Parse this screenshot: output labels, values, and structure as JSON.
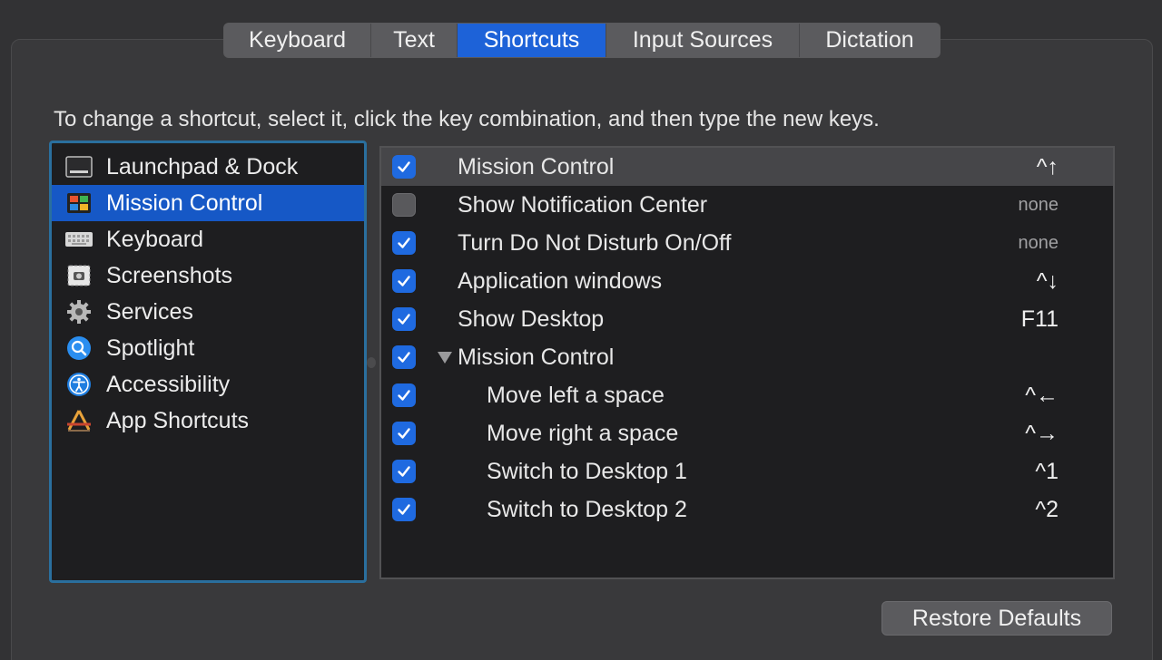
{
  "tabs": [
    {
      "label": "Keyboard",
      "active": false
    },
    {
      "label": "Text",
      "active": false
    },
    {
      "label": "Shortcuts",
      "active": true
    },
    {
      "label": "Input Sources",
      "active": false
    },
    {
      "label": "Dictation",
      "active": false
    }
  ],
  "instruction": "To change a shortcut, select it, click the key combination, and then type the new keys.",
  "categories": [
    {
      "label": "Launchpad & Dock",
      "icon": "launchpad-icon",
      "selected": false
    },
    {
      "label": "Mission Control",
      "icon": "mission-control-icon",
      "selected": true
    },
    {
      "label": "Keyboard",
      "icon": "keyboard-icon",
      "selected": false
    },
    {
      "label": "Screenshots",
      "icon": "screenshot-icon",
      "selected": false
    },
    {
      "label": "Services",
      "icon": "gear-icon",
      "selected": false
    },
    {
      "label": "Spotlight",
      "icon": "magnifier-icon",
      "selected": false
    },
    {
      "label": "Accessibility",
      "icon": "accessibility-icon",
      "selected": false
    },
    {
      "label": "App Shortcuts",
      "icon": "app-store-icon",
      "selected": false
    }
  ],
  "shortcuts": [
    {
      "label": "Mission Control",
      "checked": true,
      "key": "^↑",
      "selected": true
    },
    {
      "label": "Show Notification Center",
      "checked": false,
      "key": "none"
    },
    {
      "label": "Turn Do Not Disturb On/Off",
      "checked": true,
      "key": "none"
    },
    {
      "label": "Application windows",
      "checked": true,
      "key": "^↓"
    },
    {
      "label": "Show Desktop",
      "checked": true,
      "key": "F11"
    },
    {
      "label": "Mission Control",
      "checked": true,
      "key": "",
      "group": true
    },
    {
      "label": "Move left a space",
      "checked": true,
      "key": "^←",
      "indent": true
    },
    {
      "label": "Move right a space",
      "checked": true,
      "key": "^→",
      "indent": true
    },
    {
      "label": "Switch to Desktop 1",
      "checked": true,
      "key": "^1",
      "indent": true
    },
    {
      "label": "Switch to Desktop 2",
      "checked": true,
      "key": "^2",
      "indent": true
    }
  ],
  "restore_label": "Restore Defaults",
  "colors": {
    "accent": "#1d62d8",
    "selection": "#1658c6",
    "checkbox": "#1f6ae0"
  }
}
